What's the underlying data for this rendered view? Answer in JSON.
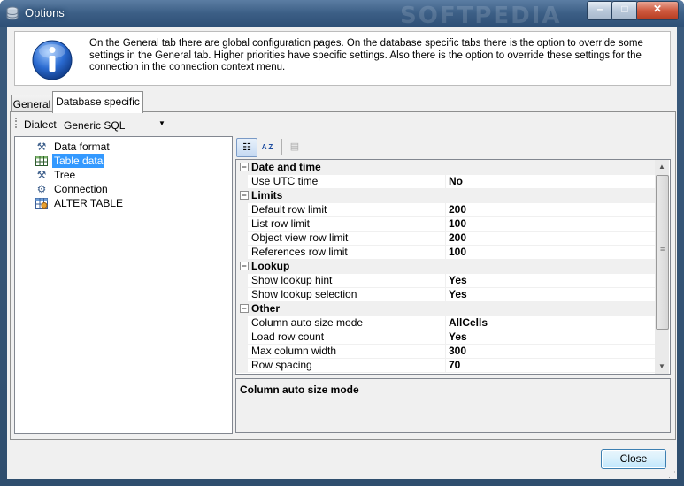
{
  "window": {
    "title": "Options",
    "watermark": "SOFTPEDIA",
    "controls": {
      "minimize": "–",
      "maximize": "□",
      "close": "✕"
    }
  },
  "info": {
    "icon": "info-icon",
    "text": "On the General tab there are global configuration pages. On the database specific tabs there is the option to override some settings in the General tab. Higher priorities have specific settings. Also there is the option to override these settings for the connection in the connection context menu."
  },
  "tabs": [
    {
      "label": "General",
      "selected": false
    },
    {
      "label": "Database specific",
      "selected": true
    }
  ],
  "dialect": {
    "label": "Dialect",
    "value": "Generic SQL"
  },
  "tree": {
    "items": [
      {
        "label": "Data format",
        "icon": "tools-icon",
        "selected": false
      },
      {
        "label": "Table data",
        "icon": "table-icon",
        "selected": true
      },
      {
        "label": "Tree",
        "icon": "tools-icon",
        "selected": false
      },
      {
        "label": "Connection",
        "icon": "connection-icon",
        "selected": false
      },
      {
        "label": "ALTER TABLE",
        "icon": "alter-table-icon",
        "selected": false
      }
    ]
  },
  "property_grid": {
    "toolbar": [
      "categorized-icon",
      "alphabetical-icon",
      "property-pages-icon"
    ],
    "alphabetical_label": "A Z",
    "categories": [
      {
        "name": "Date and time",
        "expander": "⊟",
        "rows": [
          {
            "name": "Use UTC time",
            "value": "No"
          }
        ]
      },
      {
        "name": "Limits",
        "expander": "⊟",
        "rows": [
          {
            "name": "Default row limit",
            "value": "200"
          },
          {
            "name": "List row limit",
            "value": "100"
          },
          {
            "name": "Object view row limit",
            "value": "200"
          },
          {
            "name": "References row limit",
            "value": "100"
          }
        ]
      },
      {
        "name": "Lookup",
        "expander": "⊟",
        "rows": [
          {
            "name": "Show lookup hint",
            "value": "Yes"
          },
          {
            "name": "Show lookup selection",
            "value": "Yes"
          }
        ]
      },
      {
        "name": "Other",
        "expander": "⊟",
        "rows": [
          {
            "name": "Column auto size mode",
            "value": "AllCells"
          },
          {
            "name": "Load row count",
            "value": "Yes"
          },
          {
            "name": "Max column width",
            "value": "300"
          },
          {
            "name": "Row spacing",
            "value": "70"
          }
        ]
      }
    ],
    "description_title": "Column auto size mode"
  },
  "buttons": {
    "close": "Close"
  },
  "colors": {
    "selection": "#3399ff",
    "title_bar": "#3c5f86"
  }
}
